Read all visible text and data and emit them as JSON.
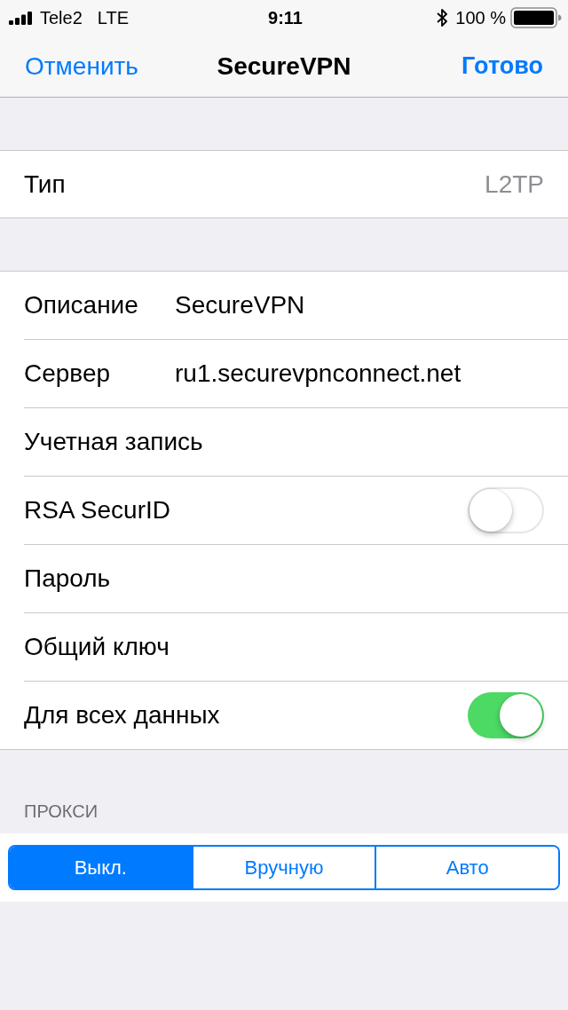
{
  "status_bar": {
    "carrier": "Tele2",
    "network": "LTE",
    "time": "9:11",
    "battery": "100 %"
  },
  "nav_bar": {
    "cancel_button": "Отменить",
    "title": "SecureVPN",
    "done_button": "Готово"
  },
  "type_row": {
    "label": "Тип",
    "value": "L2TP"
  },
  "fields": [
    {
      "kind": "text",
      "label": "Описание",
      "value": "SecureVPN"
    },
    {
      "kind": "text",
      "label": "Сервер",
      "value": "ru1.securevpnconnect.net"
    },
    {
      "kind": "text",
      "label": "Учетная запись"
    },
    {
      "kind": "switch",
      "label": "RSA SecurID",
      "on": false
    },
    {
      "kind": "text",
      "label": "Пароль"
    },
    {
      "kind": "text",
      "label": "Общий ключ"
    },
    {
      "kind": "switch",
      "label": "Для всех данных",
      "on": true
    }
  ],
  "proxy": {
    "header": "ПРОКСИ",
    "options": [
      {
        "label": "Выкл.",
        "selected": true
      },
      {
        "label": "Вручную",
        "selected": false
      },
      {
        "label": "Авто",
        "selected": false
      }
    ]
  }
}
